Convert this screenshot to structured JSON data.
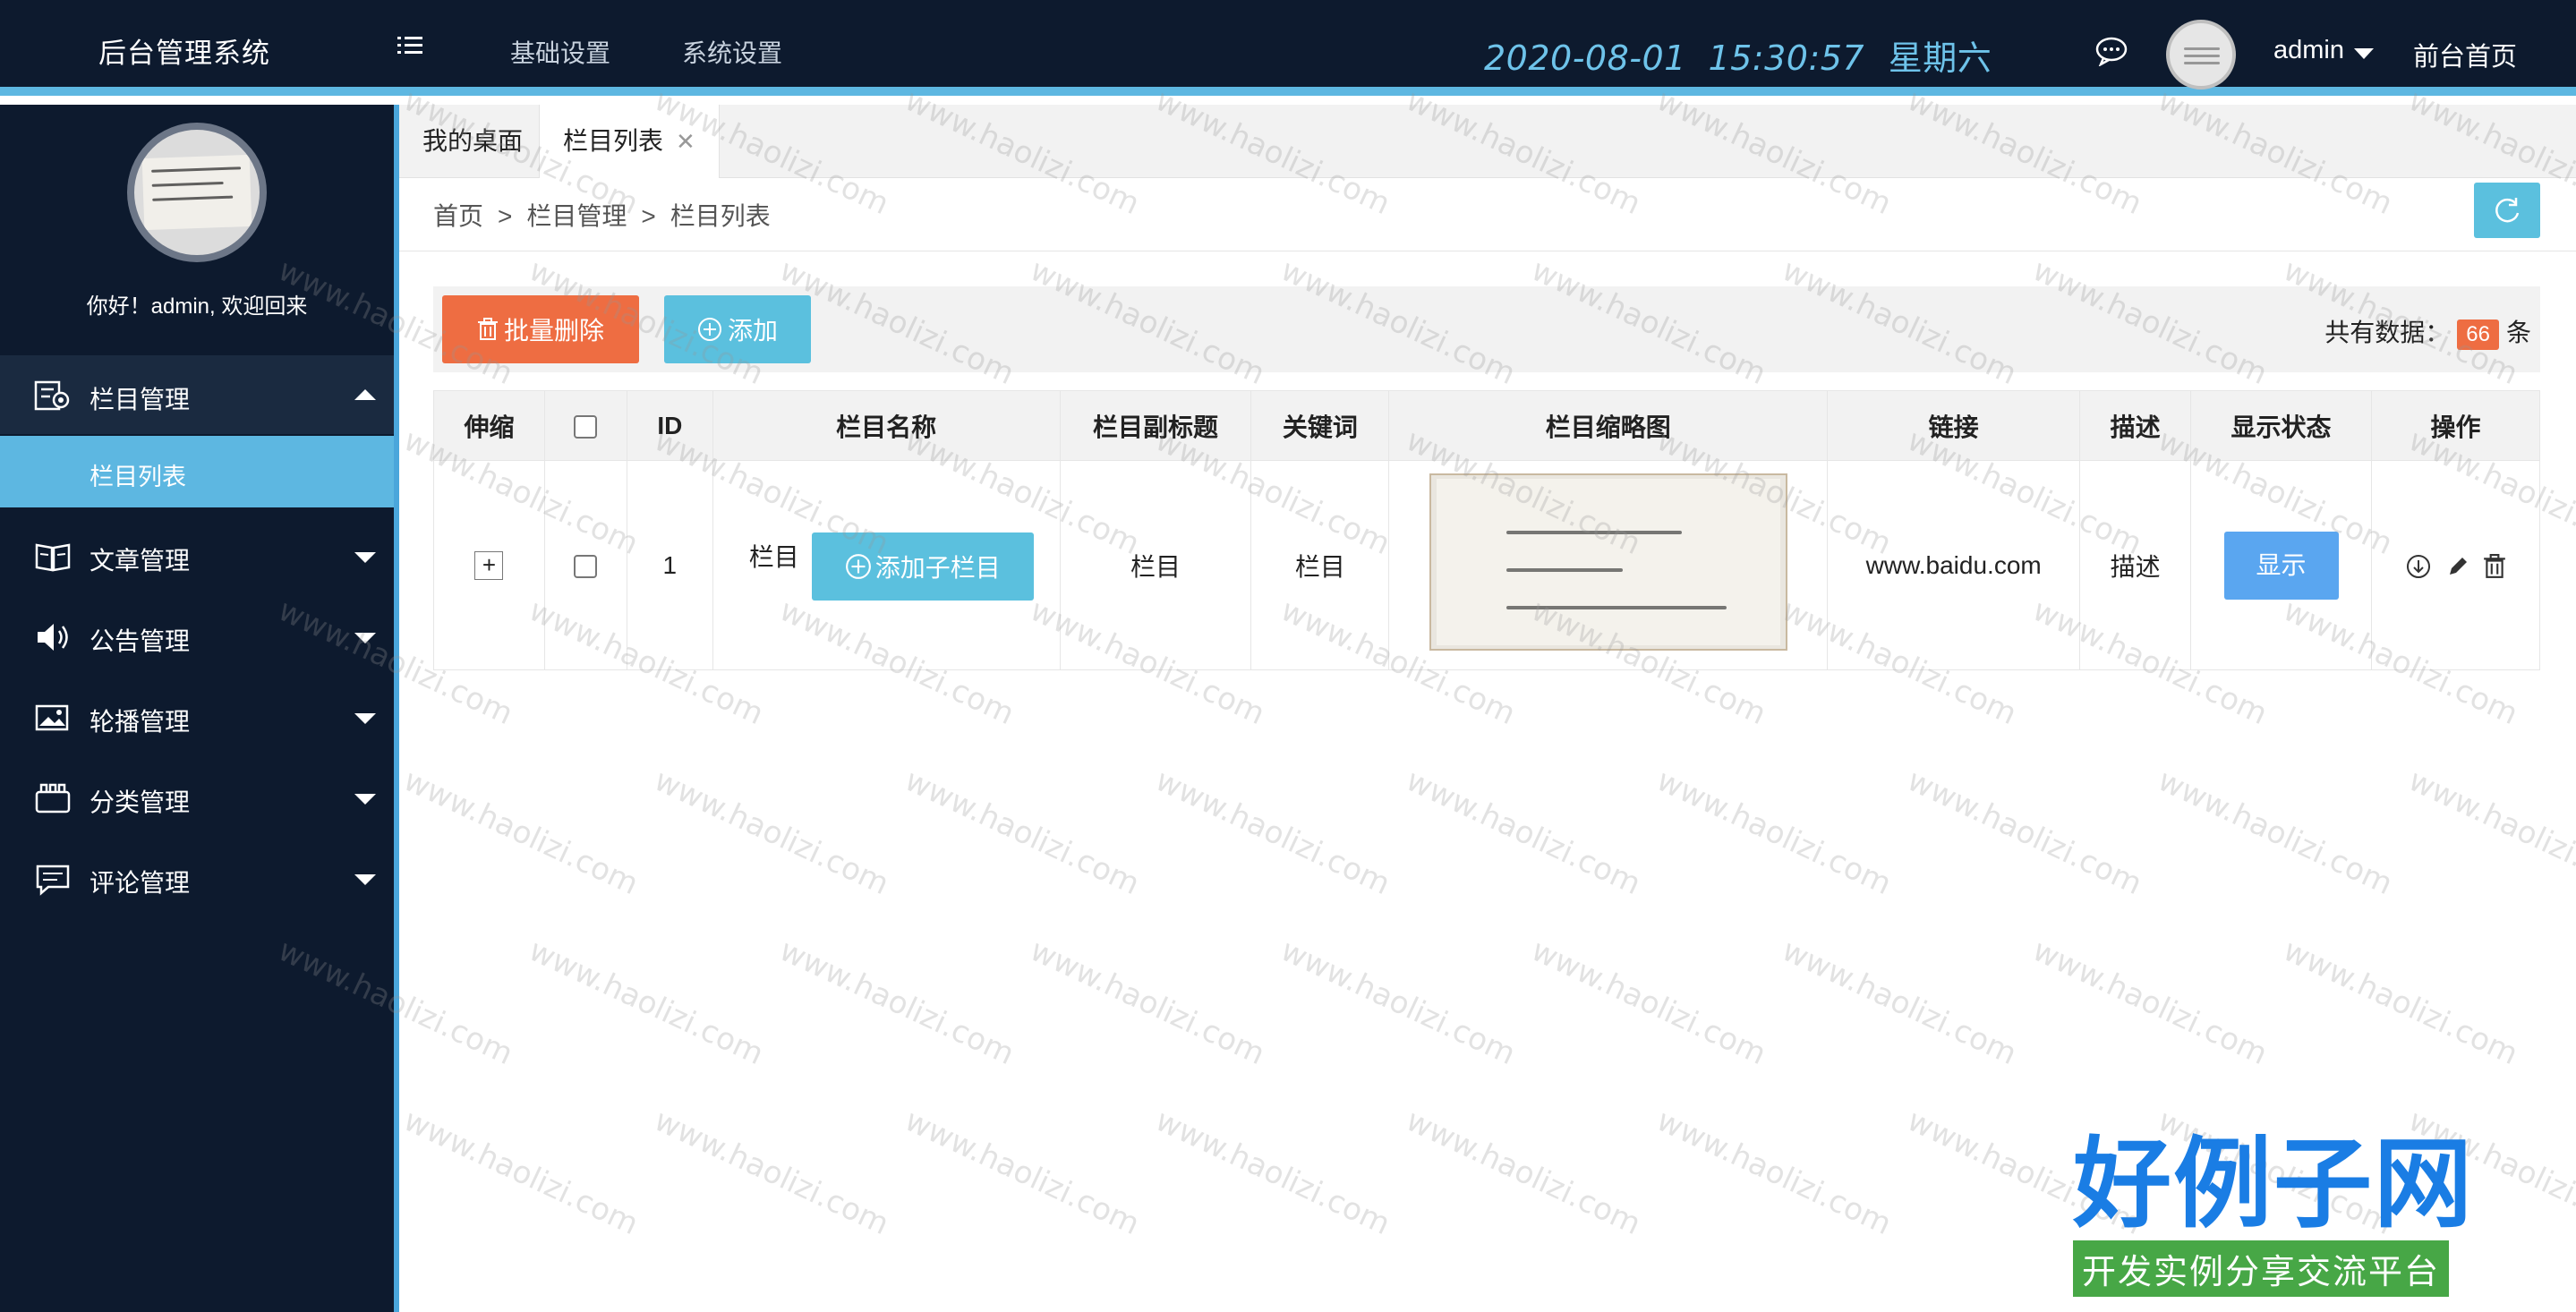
{
  "header": {
    "brand": "后台管理系统",
    "nav": [
      "基础设置",
      "系统设置"
    ],
    "clock_date": "2020-08-01",
    "clock_time": "15:30:57",
    "clock_weekday": "星期六",
    "user": "admin",
    "front_link": "前台首页"
  },
  "sidebar": {
    "welcome": "你好！admin, 欢迎回来",
    "groups": [
      {
        "label": "栏目管理",
        "icon": "settings-list-icon",
        "expanded": true
      },
      {
        "label": "文章管理",
        "icon": "book-icon"
      },
      {
        "label": "公告管理",
        "icon": "speaker-icon"
      },
      {
        "label": "轮播管理",
        "icon": "image-icon"
      },
      {
        "label": "分类管理",
        "icon": "folder-icon"
      },
      {
        "label": "评论管理",
        "icon": "comment-icon"
      }
    ],
    "active_sub": "栏目列表"
  },
  "tabs": [
    {
      "label": "我的桌面"
    },
    {
      "label": "栏目列表",
      "close": "✕"
    }
  ],
  "breadcrumb": [
    "首页",
    "栏目管理",
    "栏目列表"
  ],
  "breadcrumb_sep": ">",
  "toolbar": {
    "batch_delete": "批量删除",
    "add": "添加",
    "total_prefix": "共有数据：",
    "total_count": "66",
    "total_suffix": "条"
  },
  "table": {
    "headers": [
      "伸缩",
      "",
      "ID",
      "栏目名称",
      "栏目副标题",
      "关键词",
      "栏目缩略图",
      "链接",
      "描述",
      "显示状态",
      "操作"
    ],
    "rows": [
      {
        "expand": "+",
        "id": "1",
        "name": "栏目",
        "add_child": "添加子栏目",
        "subtitle": "栏目",
        "keywords": "栏目",
        "link": "www.baidu.com",
        "desc": "描述",
        "status": "显示"
      }
    ]
  },
  "watermark": "www.haolizi.com",
  "logo": {
    "big": "好例子网",
    "small": "开发实例分享交流平台"
  },
  "colors": {
    "header_bg": "#0d1a2e",
    "accent": "#5db7e1",
    "danger": "#ee6d42",
    "info": "#5bc0de",
    "primary": "#5aa6f0"
  }
}
